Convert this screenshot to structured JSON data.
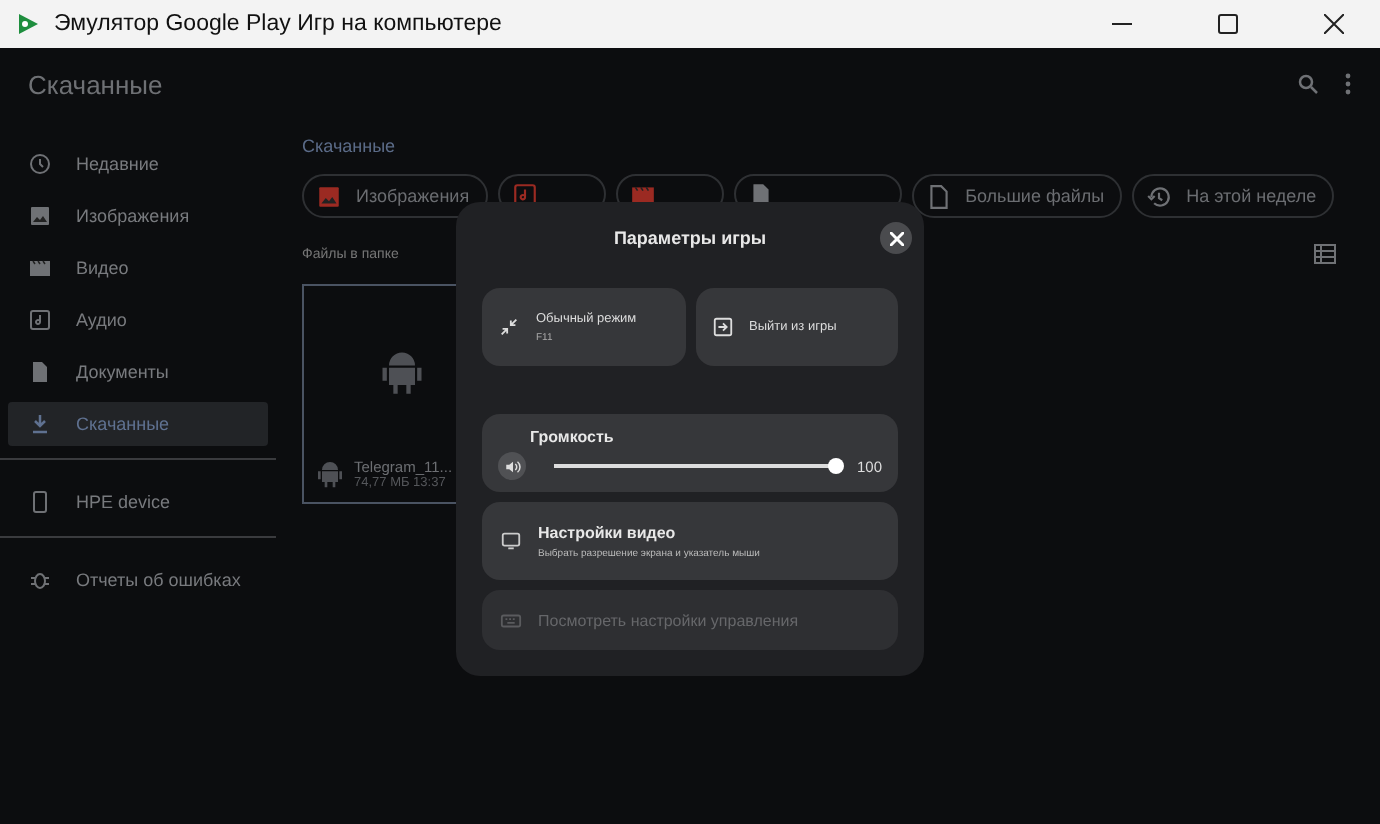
{
  "window": {
    "title": "Эмулятор Google Play Игр на компьютере"
  },
  "app_bar": {
    "title": "Скачанные"
  },
  "sidebar": {
    "groups": [
      {
        "items": [
          {
            "label": "Недавние",
            "selected": false
          },
          {
            "label": "Изображения",
            "selected": false
          },
          {
            "label": "Видео",
            "selected": false
          },
          {
            "label": "Аудио",
            "selected": false
          },
          {
            "label": "Документы",
            "selected": false
          },
          {
            "label": "Скачанные",
            "selected": true
          }
        ]
      },
      {
        "items": [
          {
            "label": "HPE device",
            "selected": false
          }
        ]
      },
      {
        "items": [
          {
            "label": "Отчеты об ошибках",
            "selected": false
          }
        ]
      }
    ]
  },
  "breadcrumb": "Скачанные",
  "chips": [
    {
      "label": "Изображения",
      "covered": false
    },
    {
      "covered": true
    },
    {
      "covered": true
    },
    {
      "covered": true
    },
    {
      "label": "Большие файлы",
      "covered": false
    },
    {
      "label": "На этой неделе",
      "covered": false
    }
  ],
  "files_label": "Файлы в папке",
  "files": [
    {
      "name": "Telegram_11...",
      "meta": "74,77 МБ 13:37"
    }
  ],
  "dialog": {
    "title": "Параметры игры",
    "actions": [
      {
        "label": "Обычный режим",
        "sublabel": "F11"
      },
      {
        "label": "Выйти из игры"
      }
    ],
    "volume": {
      "label": "Громкость",
      "level": 1,
      "reading": "100"
    },
    "options": [
      {
        "title": "Настройки видео",
        "subtitle": "Выбрать разрешение экрана и указатель мыши",
        "disabled": false
      },
      {
        "title": "Посмотреть настройки управления",
        "disabled": true
      }
    ]
  }
}
